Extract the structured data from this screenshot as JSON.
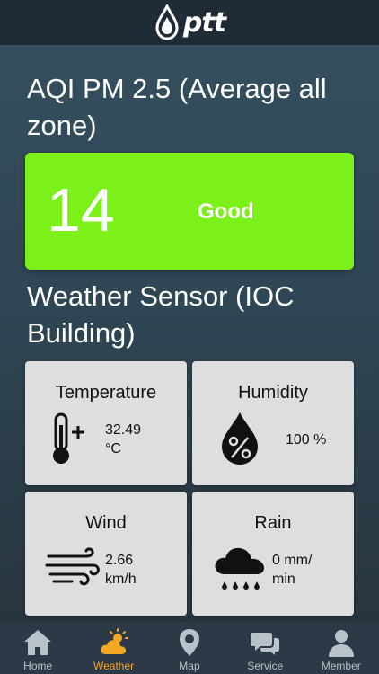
{
  "header": {
    "logo_text": "ptt"
  },
  "aqi": {
    "title": "AQI PM 2.5 (Average all zone)",
    "value": "14",
    "status": "Good",
    "status_color": "#7cf019"
  },
  "sensor": {
    "title": "Weather Sensor (IOC Building)",
    "tiles": [
      {
        "label": "Temperature",
        "value_line1": "32.49",
        "value_line2": "°C",
        "icon": "thermometer-plus-icon"
      },
      {
        "label": "Humidity",
        "value_line1": "100 %",
        "value_line2": "",
        "icon": "humidity-drop-icon"
      },
      {
        "label": "Wind",
        "value_line1": "2.66",
        "value_line2": "km/h",
        "icon": "wind-icon"
      },
      {
        "label": "Rain",
        "value_line1": "0 mm/",
        "value_line2": "min",
        "icon": "rain-cloud-icon"
      }
    ]
  },
  "tabs": [
    {
      "label": "Home",
      "icon": "home-icon",
      "active": false
    },
    {
      "label": "Weather",
      "icon": "weather-icon",
      "active": true
    },
    {
      "label": "Map",
      "icon": "map-pin-icon",
      "active": false
    },
    {
      "label": "Service",
      "icon": "chat-icon",
      "active": false
    },
    {
      "label": "Member",
      "icon": "user-icon",
      "active": false
    }
  ],
  "colors": {
    "accent": "#f5a623",
    "tab_inactive": "#b9c2c8",
    "tile_bg": "#dedede"
  }
}
